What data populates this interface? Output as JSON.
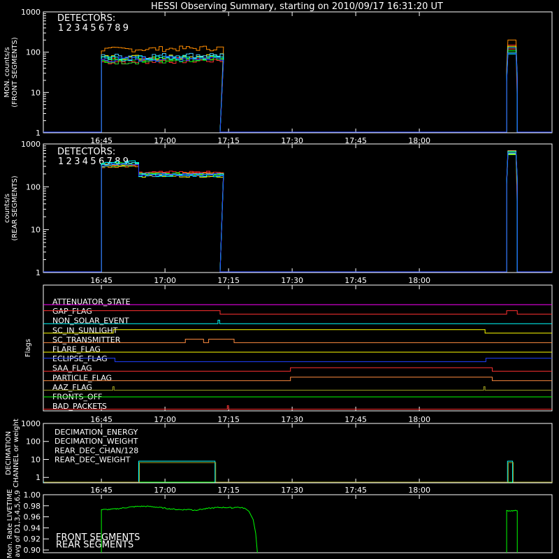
{
  "title": "HESSI Observing Summary, starting on 2010/09/17 16:31:20 UT",
  "time_ticks": [
    "16:45",
    "17:00",
    "17:15",
    "17:30",
    "17:45",
    "18:00"
  ],
  "colors": {
    "d1": "#ff3030",
    "d2": "#ff2020",
    "d3": "#ff8c00",
    "d4": "#ffff00",
    "d5": "#30d030",
    "d6": "#00ff00",
    "d7": "#40c8ff",
    "d8": "#00ffff",
    "d9": "#2040ff",
    "front": "#00ff00",
    "rear": "#20c020"
  },
  "chart_data": [
    {
      "type": "line",
      "ylabel": "MON. counts/s\n(FRONT SEGMENTS)",
      "yscale": "log",
      "ylim": [
        1,
        1000
      ],
      "yticks": [
        "1",
        "10",
        "100",
        "1000"
      ],
      "legend_title": "DETECTORS:",
      "detectors": [
        "1",
        "2",
        "3",
        "4",
        "5",
        "6",
        "7",
        "8",
        "9"
      ],
      "xlim_min": [
        0,
        120
      ],
      "obs_windows_min": [
        [
          13.7,
          41.7
        ],
        [
          109.3,
          111.8
        ]
      ],
      "series_levels_window1": [
        55,
        62,
        110,
        70,
        55,
        60,
        75,
        65,
        62
      ],
      "series_levels_window2": [
        120,
        150,
        200,
        140,
        100,
        110,
        130,
        90,
        95
      ]
    },
    {
      "type": "line",
      "ylabel": "counts/s\n(REAR SEGMENTS)",
      "yscale": "log",
      "ylim": [
        1,
        1000
      ],
      "yticks": [
        "1",
        "10",
        "100",
        "1000"
      ],
      "legend_title": "DETECTORS:",
      "detectors": [
        "1",
        "2",
        "3",
        "4",
        "5",
        "6",
        "7",
        "8",
        "9"
      ],
      "xlim_min": [
        0,
        120
      ],
      "obs_windows_min": [
        [
          13.7,
          41.7
        ],
        [
          109.3,
          111.8
        ]
      ],
      "levels_early": [
        300,
        310,
        290,
        320,
        300,
        330,
        340,
        350,
        320
      ],
      "levels_late": [
        210,
        220,
        200,
        180,
        190,
        200,
        195,
        185,
        190
      ],
      "levels_window2": [
        600,
        620,
        700,
        580,
        560,
        650,
        680,
        600,
        620
      ]
    },
    {
      "type": "table",
      "ylabel": "Flags",
      "flags": [
        {
          "name": "ATTENUATOR_STATE",
          "color": "#ff00ff"
        },
        {
          "name": "GAP_FLAG",
          "color": "#ff3030"
        },
        {
          "name": "NON_SOLAR_EVENT",
          "color": "#00ffff"
        },
        {
          "name": "SC_IN_SUNLIGHT",
          "color": "#ffff00"
        },
        {
          "name": "SC_TRANSMITTER",
          "color": "#ff8c40"
        },
        {
          "name": "FLARE_FLAG",
          "color": "#ffff00"
        },
        {
          "name": "ECLIPSE_FLAG",
          "color": "#2040ff"
        },
        {
          "name": "SAA_FLAG",
          "color": "#ff3030"
        },
        {
          "name": "PARTICLE_FLAG",
          "color": "#ff8c40"
        },
        {
          "name": "AAZ_FLAG",
          "color": "#a0a020"
        },
        {
          "name": "FRONTS_OFF",
          "color": "#00ff00"
        },
        {
          "name": "BAD_PACKETS",
          "color": "#ff3030"
        }
      ]
    },
    {
      "type": "line",
      "ylabel": "DECIMATION\nCHANNEL or weight",
      "yscale": "log",
      "ylim": [
        0.5,
        1000
      ],
      "yticks": [
        "1",
        "10",
        "100",
        "1000"
      ],
      "series": [
        {
          "name": "DECIMATION_ENERGY",
          "color": "#00ff00"
        },
        {
          "name": "DECIMATION_WEIGHT",
          "color": "#ff8c40"
        },
        {
          "name": "REAR_DEC_CHAN/128",
          "color": "#00ffff"
        },
        {
          "name": "REAR_DEC_WEIGHT",
          "color": "#a0a020"
        }
      ],
      "rear_dec_weight_windows": [
        [
          22.5,
          40.5,
          8
        ],
        [
          109.5,
          110.7,
          8
        ]
      ]
    },
    {
      "type": "line",
      "ylabel": "Mon. Rate LIVETIME\navg of D1,3,4,5,6,9",
      "ylim": [
        0.895,
        1.0
      ],
      "yticks": [
        "0.90",
        "0.92",
        "0.94",
        "0.96",
        "0.98",
        "1.00"
      ],
      "series": [
        {
          "name": "FRONT SEGMENTS",
          "color": "#00ff00"
        },
        {
          "name": "REAR SEGMENTS",
          "color": "#20a020"
        }
      ],
      "front_windows_min": [
        [
          13.7,
          50.5
        ],
        [
          109.3,
          111.8
        ]
      ],
      "front_level": 0.976,
      "window2_level": 0.971
    }
  ]
}
